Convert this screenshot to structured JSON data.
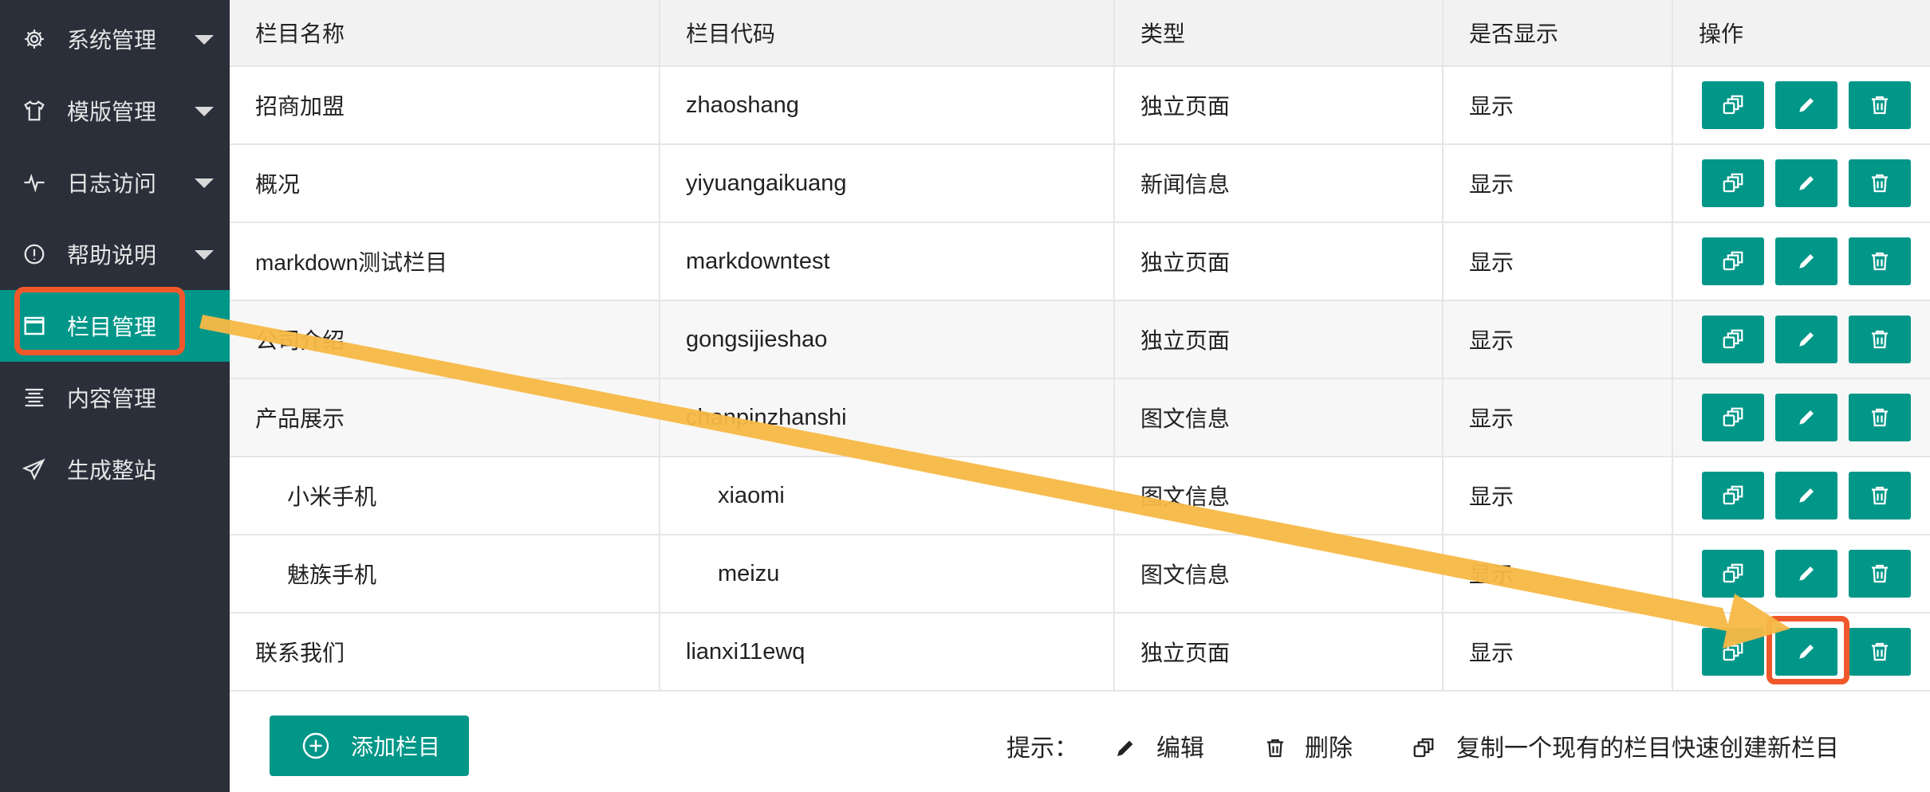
{
  "sidebar": {
    "items": [
      {
        "label": "系统管理",
        "icon": "gear-icon"
      },
      {
        "label": "模版管理",
        "icon": "tshirt-icon"
      },
      {
        "label": "日志访问",
        "icon": "pulse-icon"
      },
      {
        "label": "帮助说明",
        "icon": "info-circle-icon"
      },
      {
        "label": "栏目管理",
        "icon": "window-icon",
        "active": true
      },
      {
        "label": "内容管理",
        "icon": "align-icon"
      },
      {
        "label": "生成整站",
        "icon": "paper-plane-icon"
      }
    ]
  },
  "table": {
    "headers": [
      "栏目名称",
      "栏目代码",
      "类型",
      "是否显示",
      "操作"
    ],
    "rows": [
      {
        "name": "招商加盟",
        "code": "zhaoshang",
        "type": "独立页面",
        "show": "显示"
      },
      {
        "name": "概况",
        "code": "yiyuangaikuang",
        "type": "新闻信息",
        "show": "显示"
      },
      {
        "name": "markdown测试栏目",
        "code": "markdowntest",
        "type": "独立页面",
        "show": "显示"
      },
      {
        "name": "公司介绍",
        "code": "gongsijieshao",
        "type": "独立页面",
        "show": "显示"
      },
      {
        "name": "产品展示",
        "code": "chanpinzhanshi",
        "type": "图文信息",
        "show": "显示"
      },
      {
        "name": "小米手机",
        "code": "xiaomi",
        "type": "图文信息",
        "show": "显示",
        "child": true
      },
      {
        "name": "魅族手机",
        "code": "meizu",
        "type": "图文信息",
        "show": "显示",
        "child": true
      },
      {
        "name": "联系我们",
        "code": "lianxi11ewq",
        "type": "独立页面",
        "show": "显示"
      }
    ],
    "actions": {
      "copy_icon": "copy-icon",
      "edit_icon": "pencil-icon",
      "delete_icon": "trash-icon"
    }
  },
  "footer": {
    "add_label": "添加栏目",
    "tip_prefix": "提示：",
    "tip_edit": "编辑",
    "tip_delete": "删除",
    "tip_copy": "复制一个现有的栏目快速创建新栏目"
  },
  "colors": {
    "accent": "#009688",
    "sidebar_bg": "#2b2f3a",
    "highlight": "#f0582c",
    "arrow": "#f7b844"
  }
}
